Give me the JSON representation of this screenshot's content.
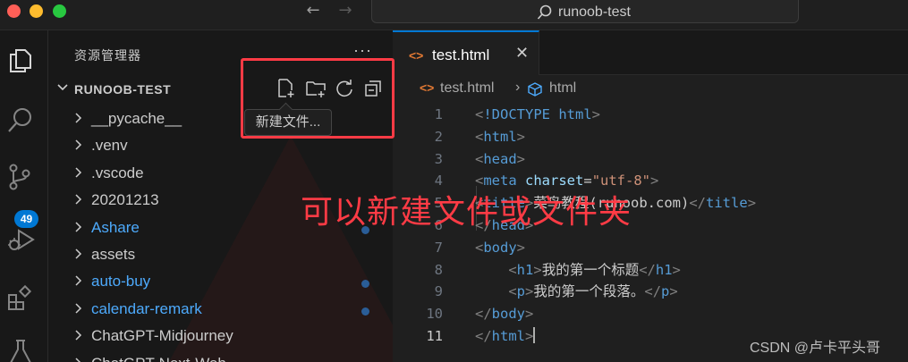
{
  "titlebar": {
    "search_text": "runoob-test",
    "back_glyph": "←",
    "forward_glyph": "→"
  },
  "activity": {
    "items": [
      "files-icon",
      "search-icon",
      "source-control-icon",
      "run-debug-icon",
      "extensions-icon",
      "testing-icon"
    ],
    "scm_badge": "49",
    "accent": "#0078d4"
  },
  "sidebar": {
    "title": "资源管理器",
    "more": "···",
    "root_label": "RUNOOB-TEST",
    "toolbar": [
      "new-file-icon",
      "new-folder-icon",
      "refresh-icon",
      "collapse-all-icon"
    ],
    "tooltip": "新建文件...",
    "tree": [
      {
        "label": "__pycache__",
        "modified": false,
        "dot": false
      },
      {
        "label": ".venv",
        "modified": false,
        "dot": false
      },
      {
        "label": ".vscode",
        "modified": false,
        "dot": false
      },
      {
        "label": "20201213",
        "modified": false,
        "dot": false
      },
      {
        "label": "Ashare",
        "modified": true,
        "dot": true
      },
      {
        "label": "assets",
        "modified": false,
        "dot": false
      },
      {
        "label": "auto-buy",
        "modified": true,
        "dot": true
      },
      {
        "label": "calendar-remark",
        "modified": true,
        "dot": true
      },
      {
        "label": "ChatGPT-Midjourney",
        "modified": false,
        "dot": false
      },
      {
        "label": "ChatGPT-Next-Web",
        "modified": false,
        "dot": false
      }
    ]
  },
  "editor": {
    "tab_icon": "<>",
    "tab_label": "test.html",
    "tab_close": "✕",
    "breadcrumb_file": "test.html",
    "breadcrumb_sep": "›",
    "breadcrumb_symbol": "html",
    "lines": [
      {
        "n": "1",
        "html": "<span class='br'>&lt;</span><span class='tag'>!DOCTYPE html</span><span class='br'>&gt;</span>"
      },
      {
        "n": "2",
        "html": "<span class='br'>&lt;</span><span class='tag'>html</span><span class='br'>&gt;</span>"
      },
      {
        "n": "3",
        "html": "<span class='br'>&lt;</span><span class='tag'>head</span><span class='br'>&gt;</span>"
      },
      {
        "n": "4",
        "html": "<span class='br'>&lt;</span><span class='tag'>meta</span> <span class='attr'>charset</span>=<span class='str'>\"utf-8\"</span><span class='br'>&gt;</span>"
      },
      {
        "n": "5",
        "html": "<span class='br'>&lt;</span><span class='tag'>title</span><span class='br'>&gt;</span>菜鸟教程(runoob.com)<span class='br'>&lt;/</span><span class='tag'>title</span><span class='br'>&gt;</span>"
      },
      {
        "n": "6",
        "html": "<span class='br'>&lt;/</span><span class='tag'>head</span><span class='br'>&gt;</span>"
      },
      {
        "n": "7",
        "html": "<span class='br'>&lt;</span><span class='tag'>body</span><span class='br'>&gt;</span>"
      },
      {
        "n": "8",
        "html": "    <span class='br'>&lt;</span><span class='tag'>h1</span><span class='br'>&gt;</span>我的第一个标题<span class='br'>&lt;/</span><span class='tag'>h1</span><span class='br'>&gt;</span>"
      },
      {
        "n": "9",
        "html": "    <span class='br'>&lt;</span><span class='tag'>p</span><span class='br'>&gt;</span>我的第一个段落。<span class='br'>&lt;/</span><span class='tag'>p</span><span class='br'>&gt;</span>"
      },
      {
        "n": "10",
        "html": "<span class='br'>&lt;/</span><span class='tag'>body</span><span class='br'>&gt;</span>"
      },
      {
        "n": "11",
        "html": "<span class='br'>&lt;/</span><span class='tag'>html</span><span class='br'>&gt;</span><span class='cursor'></span>"
      }
    ],
    "current_line": "11"
  },
  "annotation": {
    "text": "可以新建文件或文件夹",
    "color": "#ff3b45"
  },
  "watermark": "CSDN @卢卡平头哥"
}
